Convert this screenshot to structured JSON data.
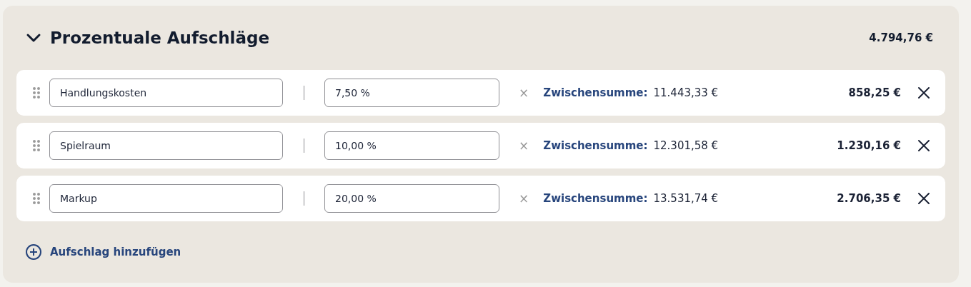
{
  "section": {
    "title": "Prozentuale Aufschläge",
    "expanded": true,
    "total": "4.794,76 €",
    "rows": [
      {
        "name": "Handlungskosten",
        "percent": "7,50 %",
        "times": "×",
        "subtotal_label": "Zwischensumme:",
        "subtotal": "11.443,33 €",
        "amount": "858,25 €"
      },
      {
        "name": "Spielraum",
        "percent": "10,00 %",
        "times": "×",
        "subtotal_label": "Zwischensumme:",
        "subtotal": "12.301,58 €",
        "amount": "1.230,16 €"
      },
      {
        "name": "Markup",
        "percent": "20,00 %",
        "times": "×",
        "subtotal_label": "Zwischensumme:",
        "subtotal": "13.531,74 €",
        "amount": "2.706,35 €"
      }
    ],
    "add_label": "Aufschlag hinzufügen"
  }
}
